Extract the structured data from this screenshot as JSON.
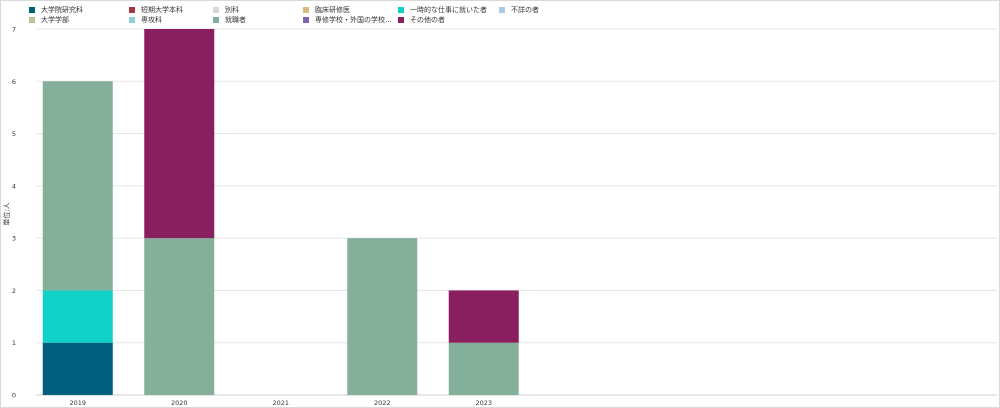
{
  "chart_data": {
    "type": "bar",
    "stacked": true,
    "categories": [
      "2019",
      "2020",
      "2021",
      "2022",
      "2023"
    ],
    "ylabel": "単位:人",
    "ylim": [
      0,
      7
    ],
    "yticks": [
      "0",
      "1",
      "2",
      "3",
      "4",
      "5",
      "6",
      "7"
    ],
    "grid": true,
    "legend_position": "top-left",
    "series": [
      {
        "name": "大学院研究科",
        "color": "#005f7f",
        "values": [
          1,
          0,
          0,
          0,
          0
        ]
      },
      {
        "name": "短期大学本科",
        "color": "#a23a43",
        "values": [
          0,
          0,
          0,
          0,
          0
        ]
      },
      {
        "name": "別科",
        "color": "#d7d7d7",
        "values": [
          0,
          0,
          0,
          0,
          0
        ]
      },
      {
        "name": "臨床研修医",
        "color": "#d8b980",
        "values": [
          0,
          0,
          0,
          0,
          0
        ]
      },
      {
        "name": "一時的な仕事に就いた者",
        "color": "#11d0c8",
        "values": [
          1,
          0,
          0,
          0,
          0
        ]
      },
      {
        "name": "不詳の者",
        "color": "#aacbe7",
        "values": [
          0,
          0,
          0,
          0,
          0
        ]
      },
      {
        "name": "大学学部",
        "color": "#bec29b",
        "values": [
          0,
          0,
          0,
          0,
          0
        ]
      },
      {
        "name": "専攻科",
        "color": "#8fd1d5",
        "values": [
          0,
          0,
          0,
          0,
          0
        ]
      },
      {
        "name": "就職者",
        "color": "#84b09b",
        "values": [
          4,
          3,
          0,
          3,
          1
        ]
      },
      {
        "name": "専修学校・外国の学校...",
        "color": "#7b65b3",
        "values": [
          0,
          0,
          0,
          0,
          0
        ]
      },
      {
        "name": "その他の者",
        "color": "#8a1f5f",
        "values": [
          0,
          4,
          0,
          0,
          1
        ]
      }
    ]
  }
}
